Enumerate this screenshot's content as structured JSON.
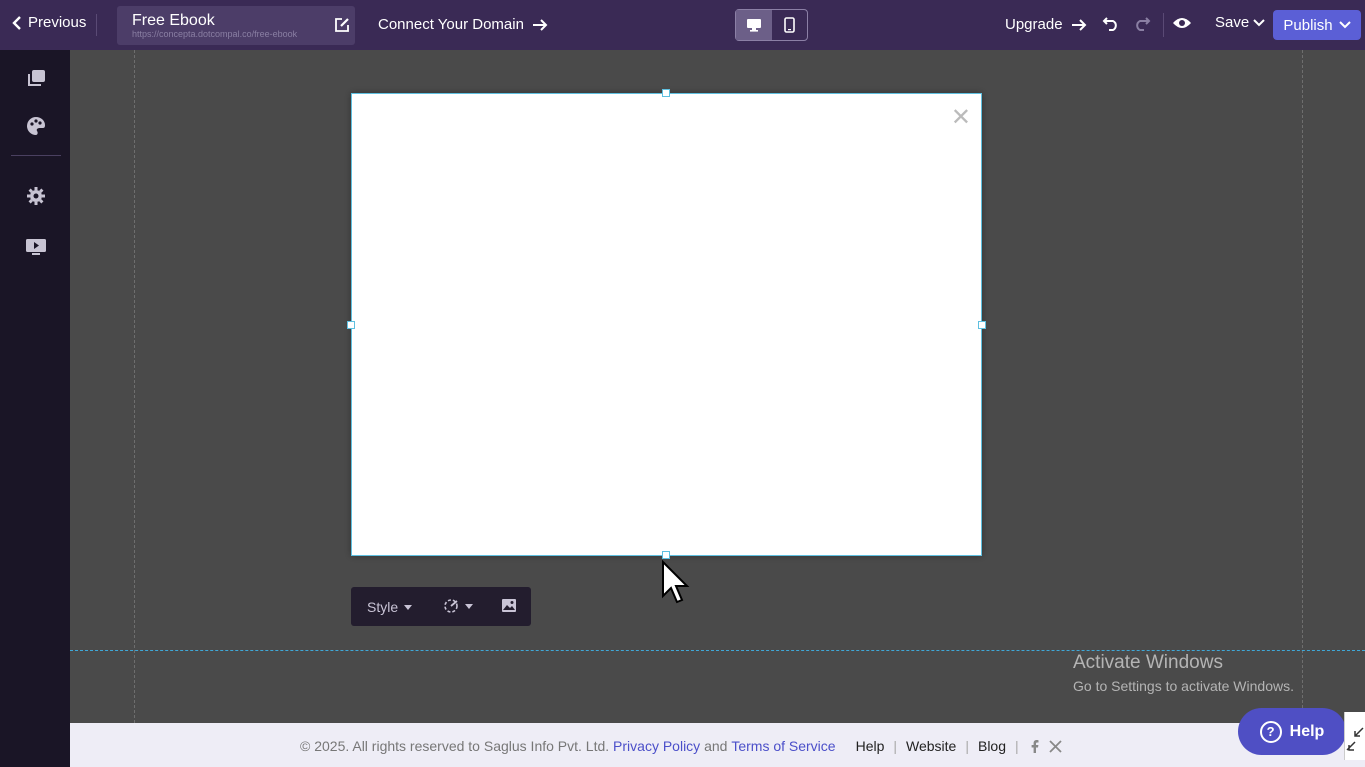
{
  "topbar": {
    "previous_label": "Previous",
    "page_title": "Free Ebook",
    "page_url": "https://concepta.dotcompal.co/free-ebook",
    "connect_domain_label": "Connect Your Domain",
    "upgrade_label": "Upgrade",
    "save_label": "Save",
    "publish_label": "Publish",
    "active_device": "desktop"
  },
  "sidebar": {
    "items": [
      {
        "icon": "pages-icon"
      },
      {
        "icon": "palette-icon"
      },
      {
        "icon": "gear-icon"
      },
      {
        "icon": "monitor-play-icon"
      }
    ]
  },
  "popup": {
    "close_symbol": "✕"
  },
  "element_toolbar": {
    "style_label": "Style"
  },
  "watermark": {
    "line1": "Activate Windows",
    "line2": "Go to Settings to activate Windows."
  },
  "footer": {
    "copyright": "©  2025. All rights reserved to Saglus Info Pvt. Ltd.",
    "privacy_label": "Privacy Policy",
    "and_text": "and",
    "terms_label": "Terms of Service",
    "help_label": "Help",
    "website_label": "Website",
    "blog_label": "Blog"
  },
  "help_button": {
    "label": "Help",
    "symbol": "?"
  },
  "colors": {
    "topbar_bg": "#3a2a55",
    "sidebar_bg": "#1a1526",
    "publish_bg": "#5b5fd6",
    "canvas_bg": "#4a4a4a",
    "help_bg": "#4f4fc4"
  }
}
